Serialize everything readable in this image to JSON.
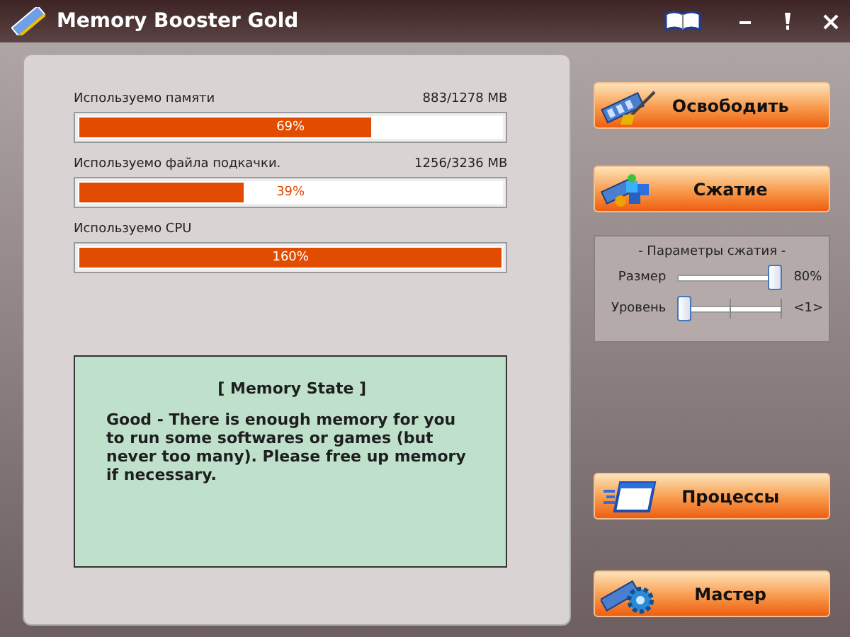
{
  "window": {
    "title": "Memory Booster Gold"
  },
  "meters": [
    {
      "label": "Используемо памяти",
      "reading": "883/1278 MB",
      "level": 0.69,
      "value_text": "69%"
    },
    {
      "label": "Используемо файла подкачки.",
      "reading": "1256/3236 MB",
      "level": 0.39,
      "value_text": "39%"
    },
    {
      "label": "Используемо CPU",
      "level": 1,
      "value_text": "160%"
    }
  ],
  "memory_state": {
    "title": "[ Memory State ]",
    "text": "Good - There is enough memory for you to run some softwares or games (but never too many). Please free up memory if necessary."
  },
  "buttons": [
    {
      "label": "Освободить",
      "kind": "free"
    },
    {
      "label": "Сжатие",
      "kind": "compress"
    }
  ],
  "compression": {
    "title": "- Параметры сжатия -",
    "sliders": [
      {
        "label": "Размер",
        "level": 1,
        "reading": "80%",
        "kind": "plain"
      },
      {
        "label": "Уровень",
        "level": 0,
        "reading": "<1>",
        "kind": "ticks"
      }
    ]
  },
  "lower_buttons": [
    {
      "label": "Процессы",
      "kind": "processes"
    },
    {
      "label": "Мастер",
      "kind": "wizard"
    }
  ]
}
